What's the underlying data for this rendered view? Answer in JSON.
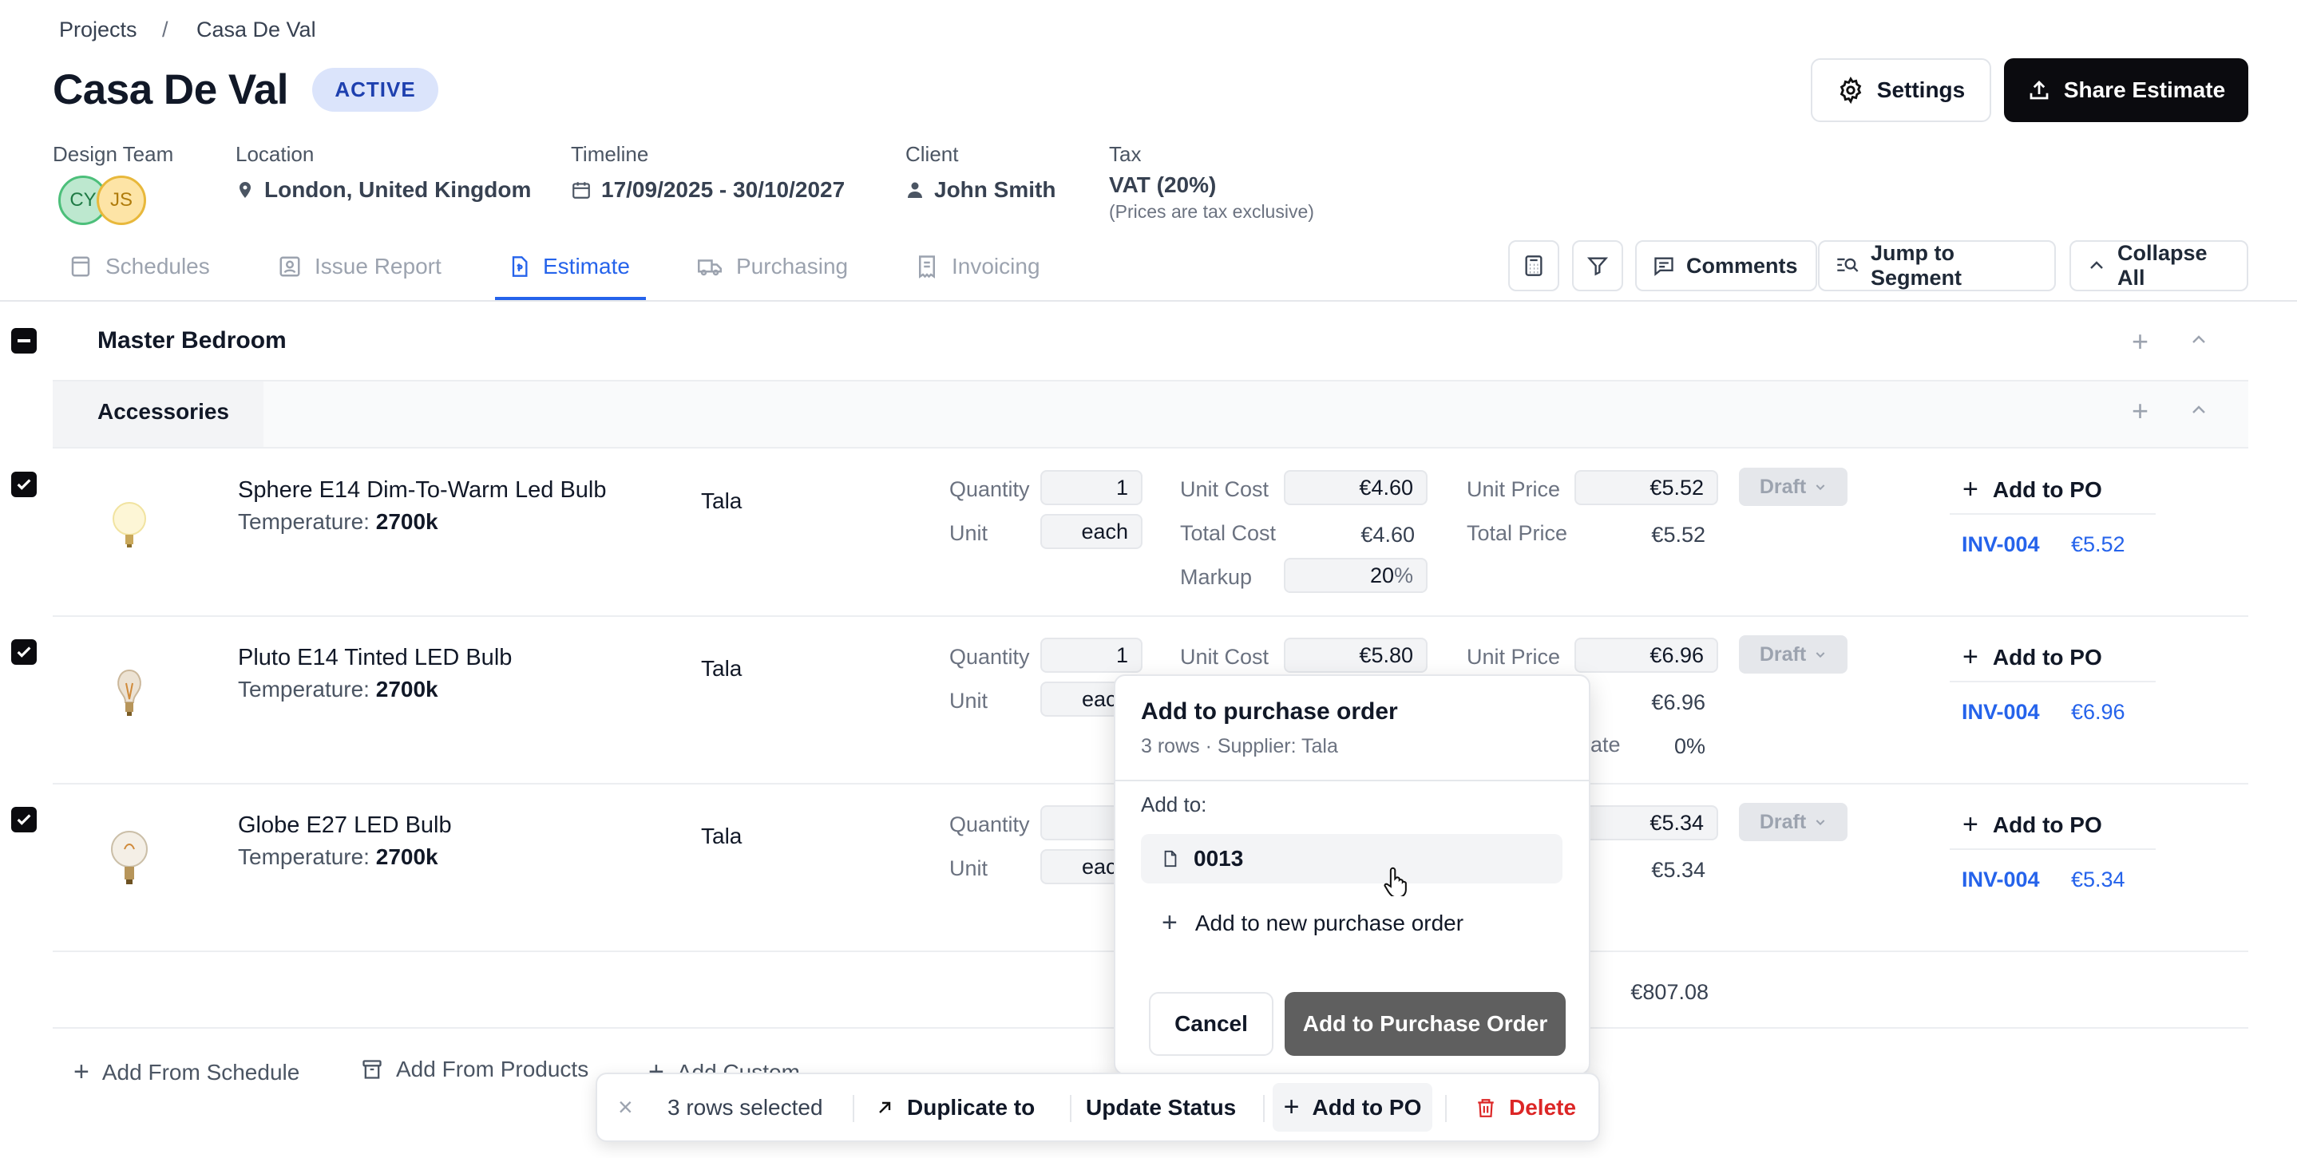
{
  "breadcrumb": {
    "root": "Projects",
    "separator": "/",
    "current": "Casa De Val"
  },
  "project": {
    "title": "Casa De Val",
    "status": "ACTIVE"
  },
  "header_buttons": {
    "settings": "Settings",
    "share": "Share Estimate"
  },
  "meta": {
    "design_team": {
      "label": "Design Team",
      "members": [
        "CY",
        "JS"
      ]
    },
    "location": {
      "label": "Location",
      "value": "London, United Kingdom"
    },
    "timeline": {
      "label": "Timeline",
      "value": "17/09/2025 - 30/10/2027"
    },
    "client": {
      "label": "Client",
      "value": "John Smith"
    },
    "tax": {
      "label": "Tax",
      "value": "VAT (20%)",
      "note": "(Prices are tax exclusive)"
    }
  },
  "tabs": [
    {
      "label": "Schedules",
      "icon": "schedule-icon"
    },
    {
      "label": "Issue Report",
      "icon": "issue-report-icon"
    },
    {
      "label": "Estimate",
      "icon": "estimate-icon",
      "active": true
    },
    {
      "label": "Purchasing",
      "icon": "truck-icon"
    },
    {
      "label": "Invoicing",
      "icon": "invoice-icon"
    }
  ],
  "toolbar": {
    "comments": "Comments",
    "jump": "Jump to Segment",
    "collapse": "Collapse All"
  },
  "section": {
    "title": "Master Bedroom",
    "subsection": "Accessories"
  },
  "labels": {
    "quantity": "Quantity",
    "unit": "Unit",
    "unit_cost": "Unit Cost",
    "total_cost": "Total Cost",
    "markup": "Markup",
    "unit_price": "Unit Price",
    "total_price": "Total Price",
    "rate_partial": "ate",
    "add_to_po": "Add to PO",
    "percent": "%"
  },
  "items": [
    {
      "name": "Sphere E14 Dim-To-Warm Led Bulb",
      "temp_label": "Temperature:",
      "temp": "2700k",
      "supplier": "Tala",
      "quantity": "1",
      "unit": "each",
      "unit_cost": "€4.60",
      "total_cost": "€4.60",
      "markup": "20",
      "unit_price": "€5.52",
      "total_price": "€5.52",
      "status": "Draft",
      "invoice": "INV-004",
      "invoice_amount": "€5.52"
    },
    {
      "name": "Pluto E14 Tinted LED Bulb",
      "temp_label": "Temperature:",
      "temp": "2700k",
      "supplier": "Tala",
      "quantity": "1",
      "unit": "eac",
      "unit_cost": "€5.80",
      "unit_price": "€6.96",
      "total_price": "€6.96",
      "rate": "0%",
      "status": "Draft",
      "invoice": "INV-004",
      "invoice_amount": "€6.96"
    },
    {
      "name": "Globe E27 LED Bulb",
      "temp_label": "Temperature:",
      "temp": "2700k",
      "supplier": "Tala",
      "quantity": "",
      "unit": "eac",
      "unit_price": "€5.34",
      "total_price": "€5.34",
      "status": "Draft",
      "invoice": "INV-004",
      "invoice_amount": "€5.34"
    }
  ],
  "totals": {
    "total": "€807.08"
  },
  "footer_actions": {
    "schedule": "Add From Schedule",
    "products": "Add From Products",
    "custom": "Add Custom"
  },
  "popup": {
    "title": "Add to purchase order",
    "subtitle": "3 rows · Supplier: Tala",
    "add_to_label": "Add to:",
    "existing_po": "0013",
    "new_po": "Add to new purchase order",
    "cancel": "Cancel",
    "confirm": "Add to Purchase Order"
  },
  "selection_bar": {
    "count": "3 rows selected",
    "duplicate": "Duplicate to",
    "update_status": "Update Status",
    "add_to_po": "Add to PO",
    "delete": "Delete"
  },
  "colors": {
    "accent": "#2563eb",
    "danger": "#dc2626",
    "dark": "#0b0b0f"
  }
}
